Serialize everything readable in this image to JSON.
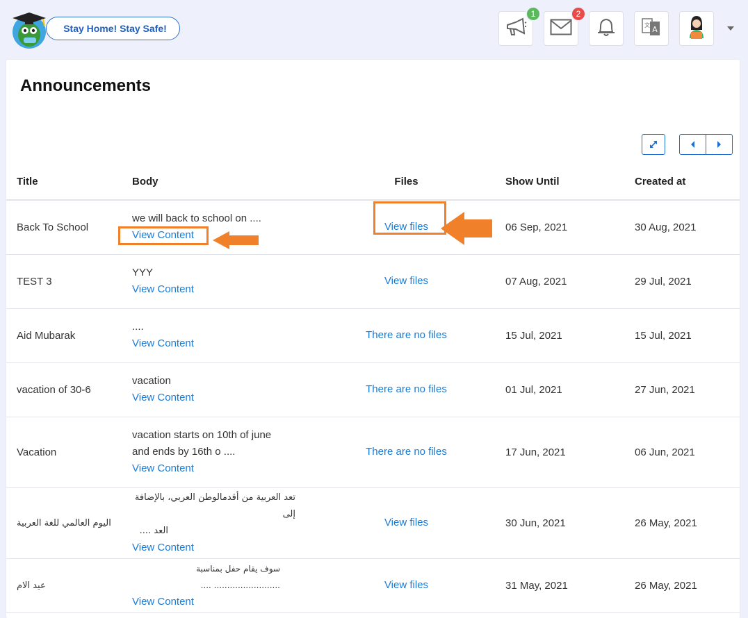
{
  "header": {
    "slogan": "Stay Home! Stay Safe!",
    "icons": [
      {
        "name": "megaphone-icon",
        "badge": "1",
        "badge_color": "#5cb85c"
      },
      {
        "name": "mail-icon",
        "badge": "2",
        "badge_color": "#e94b4b"
      },
      {
        "name": "bell-icon",
        "badge": ""
      },
      {
        "name": "translate-icon",
        "badge": ""
      },
      {
        "name": "avatar",
        "badge": ""
      }
    ]
  },
  "page": {
    "title": "Announcements"
  },
  "table": {
    "columns": [
      "Title",
      "Body",
      "Files",
      "Show Until",
      "Created at"
    ],
    "rows": [
      {
        "title": "Back To School",
        "body": "we will back to school on ....",
        "view": "View Content",
        "files": "View files",
        "show_until": "06 Sep, 2021",
        "created_at": "30 Aug, 2021"
      },
      {
        "title": "TEST 3",
        "body": "YYY",
        "view": "View Content",
        "files": "View files",
        "show_until": "07 Aug, 2021",
        "created_at": "29 Jul, 2021"
      },
      {
        "title": "Aid Mubarak",
        "body": "....",
        "view": "View Content",
        "files": "There are no files",
        "show_until": "15 Jul, 2021",
        "created_at": "15 Jul, 2021"
      },
      {
        "title": "vacation of 30-6",
        "body": "vacation",
        "view": "View Content",
        "files": "There are no files",
        "show_until": "01 Jul, 2021",
        "created_at": "27 Jun, 2021"
      },
      {
        "title": "Vacation",
        "body_line1": "vacation starts on 10th of june",
        "body_line2": "and ends by 16th o ....",
        "view": "View Content",
        "files": "There are no files",
        "show_until": "17 Jun, 2021",
        "created_at": "06 Jun, 2021"
      },
      {
        "title": "اليوم العالمي للغة العربية",
        "body_line1": "تعد العربية من أقدمالوطن العربي، بالإضافة إلى",
        "body_line2": "العد ....",
        "view": "View Content",
        "files": "View files",
        "show_until": "30 Jun, 2021",
        "created_at": "26 May, 2021"
      },
      {
        "title": "عيد الام",
        "body": "سوف يقام حفل بمناسبة ......................... ....",
        "view": "View Content",
        "files": "View files",
        "show_until": "31 May, 2021",
        "created_at": "26 May, 2021"
      }
    ]
  },
  "colors": {
    "accent": "#1a7bd6",
    "highlight": "#f0802a"
  }
}
